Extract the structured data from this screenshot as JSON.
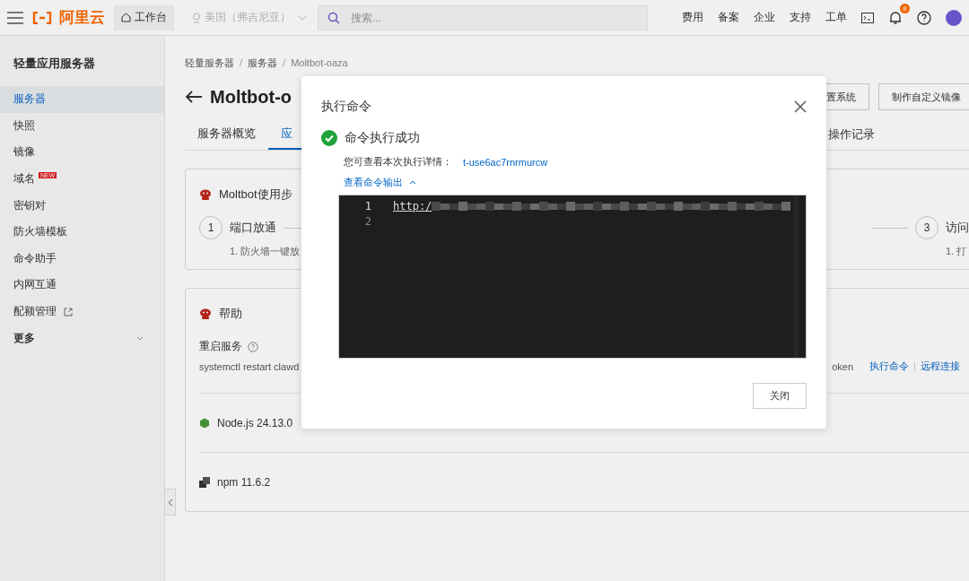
{
  "topbar": {
    "logo": "阿里云",
    "workbench": "工作台",
    "region": {
      "label": "美国（弗吉尼亚）",
      "disabled": true
    },
    "search": {
      "placeholder": "搜索..."
    },
    "links": [
      "费用",
      "备案",
      "企业",
      "支持",
      "工单"
    ],
    "notification_count": "8"
  },
  "sidebar": {
    "title": "轻量应用服务器",
    "items": [
      {
        "label": "服务器",
        "selected": true,
        "kind": "item"
      },
      {
        "label": "快照",
        "selected": false,
        "kind": "item"
      },
      {
        "label": "镜像",
        "selected": false,
        "kind": "item"
      },
      {
        "label": "域名",
        "selected": false,
        "kind": "item",
        "badge": "NEW"
      },
      {
        "label": "密钥对",
        "selected": false,
        "kind": "item"
      },
      {
        "label": "防火墙模板",
        "selected": false,
        "kind": "item"
      },
      {
        "label": "命令助手",
        "selected": false,
        "kind": "item"
      },
      {
        "label": "内网互通",
        "selected": false,
        "kind": "item"
      },
      {
        "label": "配额管理",
        "selected": false,
        "kind": "external"
      },
      {
        "label": "更多",
        "selected": false,
        "kind": "group",
        "expanded": false
      }
    ]
  },
  "breadcrumb": [
    "轻量服务器",
    "服务器",
    "Moltbot-oaza"
  ],
  "breadcrumb_separator": "/",
  "page_title": "Moltbot-o",
  "header_buttons": [
    "置系统",
    "制作自定义镜像"
  ],
  "tabs": [
    {
      "label": "服务器概览",
      "selected": false
    },
    {
      "label": "应",
      "selected": true
    }
  ],
  "tabs_right": "操作记录",
  "steps_card": {
    "title": "Moltbot使用步",
    "steps": [
      {
        "number": "1",
        "title": "端口放通",
        "desc": "1. 防火墙一键放"
      },
      {
        "number": "3",
        "title": "访问",
        "desc": "1. 打"
      }
    ]
  },
  "help_card": {
    "title": "帮助",
    "restart": {
      "label": "重启服务",
      "command": "systemctl restart clawd",
      "right_text": "oken",
      "actions": [
        "执行命令",
        "远程连接"
      ]
    },
    "versions": [
      {
        "kind": "node",
        "label": "Node.js 24.13.0"
      },
      {
        "kind": "npm",
        "label": "npm 11.6.2"
      }
    ]
  },
  "modal": {
    "title": "执行命令",
    "status": "命令执行成功",
    "detail_label": "您可查看本次执行详情：",
    "detail_link": "t-use6ac7rnrmurcw",
    "output_toggle": {
      "label": "查看命令输出",
      "expanded": true
    },
    "output_lines": [
      {
        "number": "1",
        "text": "http:/",
        "redacted": true
      },
      {
        "number": "2",
        "redacted": false
      }
    ],
    "close_button": "关闭"
  }
}
